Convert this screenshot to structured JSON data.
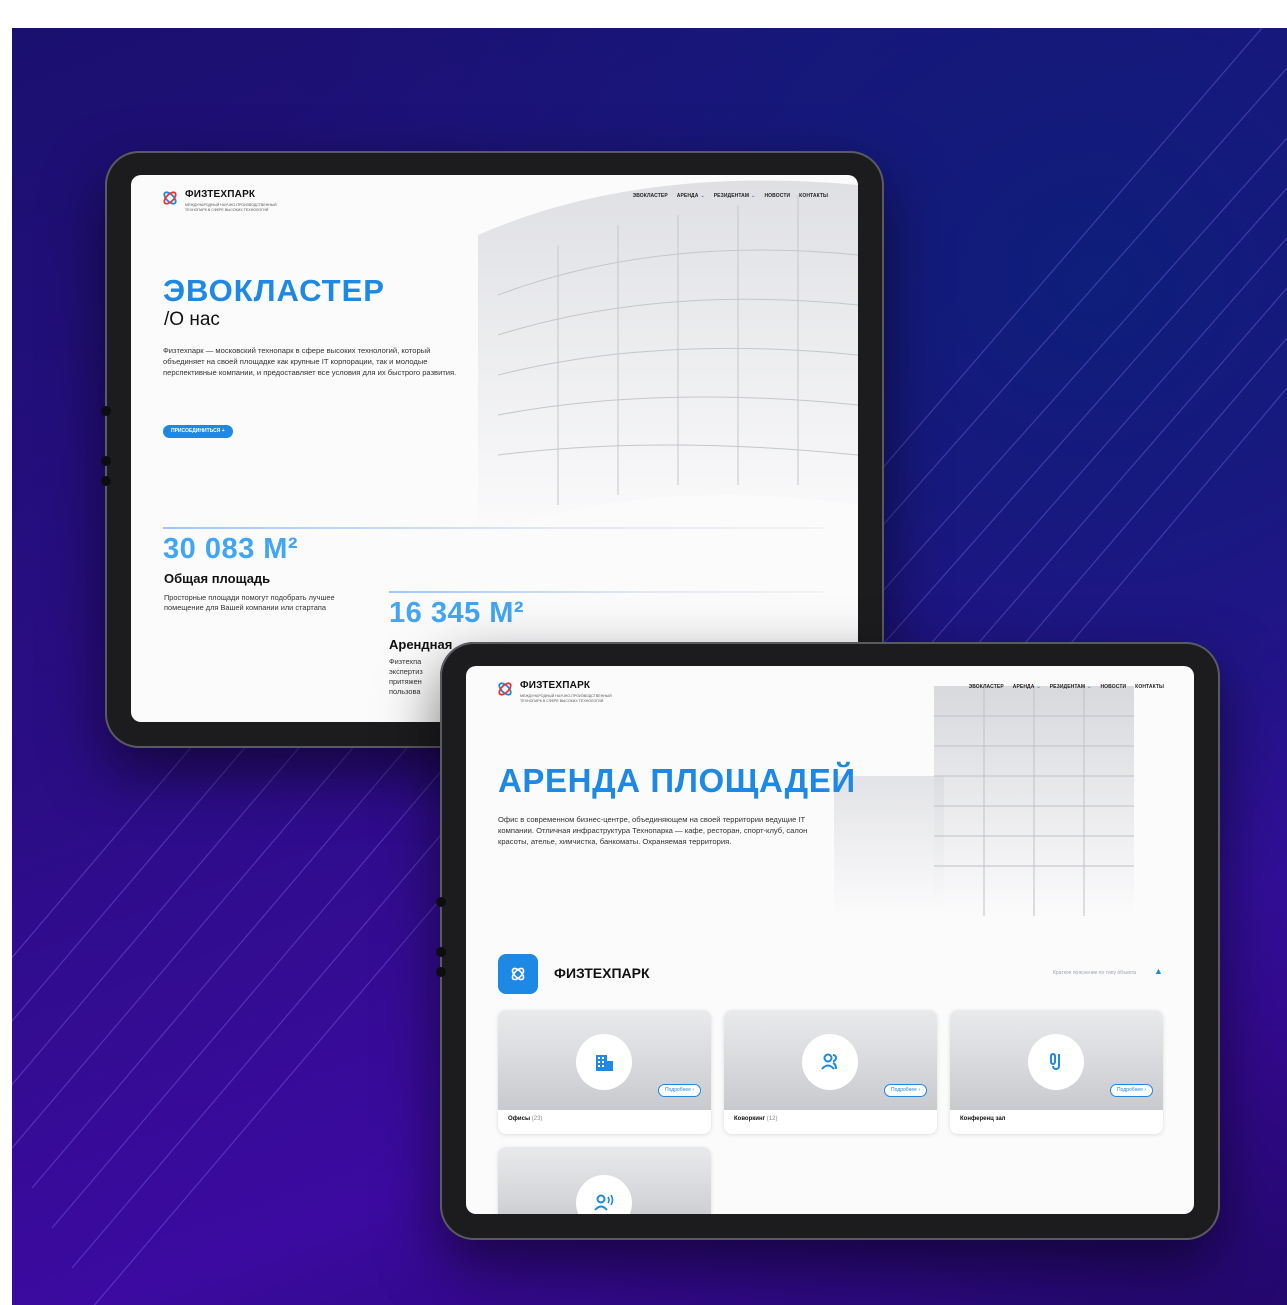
{
  "background": {
    "accent": "#2b0d86",
    "brand_blue": "#1e88e5"
  },
  "tablet1": {
    "logo": {
      "name": "ФИЗТЕХПАРК",
      "subtitle": "МЕЖДУНАРОДНЫЙ НАУЧНО-ПРОИЗВОДСТВЕННЫЙ ТЕХНОПАРК В СФЕРЕ ВЫСОКИХ ТЕХНОЛОГИЙ"
    },
    "nav": [
      "ЭВОКЛАСТЕР",
      "АРЕНДА",
      "РЕЗИДЕНТАМ",
      "НОВОСТИ",
      "КОНТАКТЫ"
    ],
    "title": "ЭВОКЛАСТЕР",
    "subtitle": "/О нас",
    "intro": "Физтехпарк — московский технопарк в сфере высоких технологий, который объединяет на своей площадке как крупные IT корпорации, так и молодые перспективные компании, и предоставляет все условия для их быстрого развития.",
    "join_button": "ПРИСОЕДИНИТЬСЯ +",
    "stats": [
      {
        "value": "30 083 М²",
        "label": "Общая площадь",
        "desc": "Просторные площади помогут подобрать лучшее помещение для Вашей компании или стартапа"
      },
      {
        "value": "16 345 М²",
        "label": "Арендная",
        "desc": "Физтехпа экспертиз притяжен пользова"
      }
    ]
  },
  "tablet2": {
    "logo": {
      "name": "ФИЗТЕХПАРК",
      "subtitle": "МЕЖДУНАРОДНЫЙ НАУЧНО-ПРОИЗВОДСТВЕННЫЙ ТЕХНОПАРК В СФЕРЕ ВЫСОКИХ ТЕХНОЛОГИЙ"
    },
    "nav": [
      "ЭВОКЛАСТЕР",
      "АРЕНДА",
      "РЕЗИДЕНТАМ",
      "НОВОСТИ",
      "КОНТАКТЫ"
    ],
    "title": "АРЕНДА ПЛОЩАДЕЙ",
    "intro": "Офис в современном бизнес-центре, объединяющем на своей территории ведущие IT компании. Отличная инфраструктура Технопарка — кафе, ресторан, спорт-клуб, салон красоты, ателье, химчистка, банкоматы. Охраняемая территория.",
    "section": {
      "title": "ФИЗТЕХПАРК",
      "hint": "Краткое пояснение по типу объекта"
    },
    "cards": [
      {
        "name": "Офисы",
        "count": "(23)",
        "more": "Подробнее ›",
        "icon": "building-icon"
      },
      {
        "name": "Коворкинг",
        "count": "(12)",
        "more": "Подробнее ›",
        "icon": "people-icon"
      },
      {
        "name": "Конференц зал",
        "count": "",
        "more": "Подробнее ›",
        "icon": "microphone-icon"
      },
      {
        "name": "",
        "count": "",
        "more": "",
        "icon": "speaker-person-icon"
      }
    ]
  }
}
